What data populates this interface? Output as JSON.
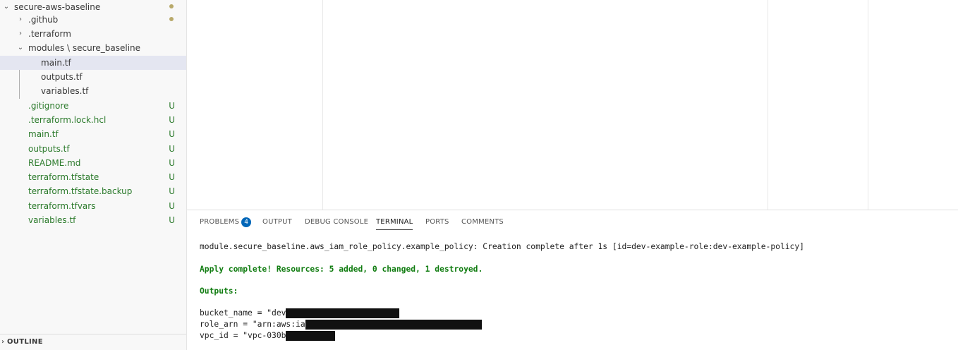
{
  "explorer": {
    "root": {
      "label": "secure-aws-baseline"
    },
    "items": [
      {
        "label": ".github",
        "status": "",
        "kind": "folder"
      },
      {
        "label": ".terraform",
        "status": "",
        "kind": "folder"
      },
      {
        "label": "modules \\ secure_baseline",
        "status": "",
        "kind": "folder-open"
      },
      {
        "label": "main.tf",
        "status": "",
        "kind": "file",
        "selected": true
      },
      {
        "label": "outputs.tf",
        "status": "",
        "kind": "file"
      },
      {
        "label": "variables.tf",
        "status": "",
        "kind": "file"
      },
      {
        "label": ".gitignore",
        "status": "U",
        "kind": "file"
      },
      {
        "label": ".terraform.lock.hcl",
        "status": "U",
        "kind": "file"
      },
      {
        "label": "main.tf",
        "status": "U",
        "kind": "file"
      },
      {
        "label": "outputs.tf",
        "status": "U",
        "kind": "file"
      },
      {
        "label": "README.md",
        "status": "U",
        "kind": "file"
      },
      {
        "label": "terraform.tfstate",
        "status": "U",
        "kind": "file"
      },
      {
        "label": "terraform.tfstate.backup",
        "status": "U",
        "kind": "file"
      },
      {
        "label": "terraform.tfvars",
        "status": "U",
        "kind": "file"
      },
      {
        "label": "variables.tf",
        "status": "U",
        "kind": "file"
      }
    ],
    "outline_label": "OUTLINE"
  },
  "panel": {
    "tabs": {
      "problems": "PROBLEMS",
      "problems_count": "4",
      "output": "OUTPUT",
      "debug": "DEBUG CONSOLE",
      "terminal": "TERMINAL",
      "ports": "PORTS",
      "comments": "COMMENTS"
    },
    "terminal": {
      "line1": "module.secure_baseline.aws_iam_role_policy.example_policy: Creation complete after 1s [id=dev-example-role:dev-example-policy]",
      "line2": "Apply complete! Resources: 5 added, 0 changed, 1 destroyed.",
      "line3": "Outputs:",
      "bucket_prefix": "bucket_name = \"dev",
      "role_prefix": "role_arn = \"arn:aws:ia",
      "vpc_prefix": "vpc_id = \"vpc-030b"
    }
  },
  "colors": {
    "git_untracked": "#2b7a2b",
    "badge_blue": "#0066b8",
    "terminal_success": "#107c10",
    "selection": "#e4e6f1"
  }
}
